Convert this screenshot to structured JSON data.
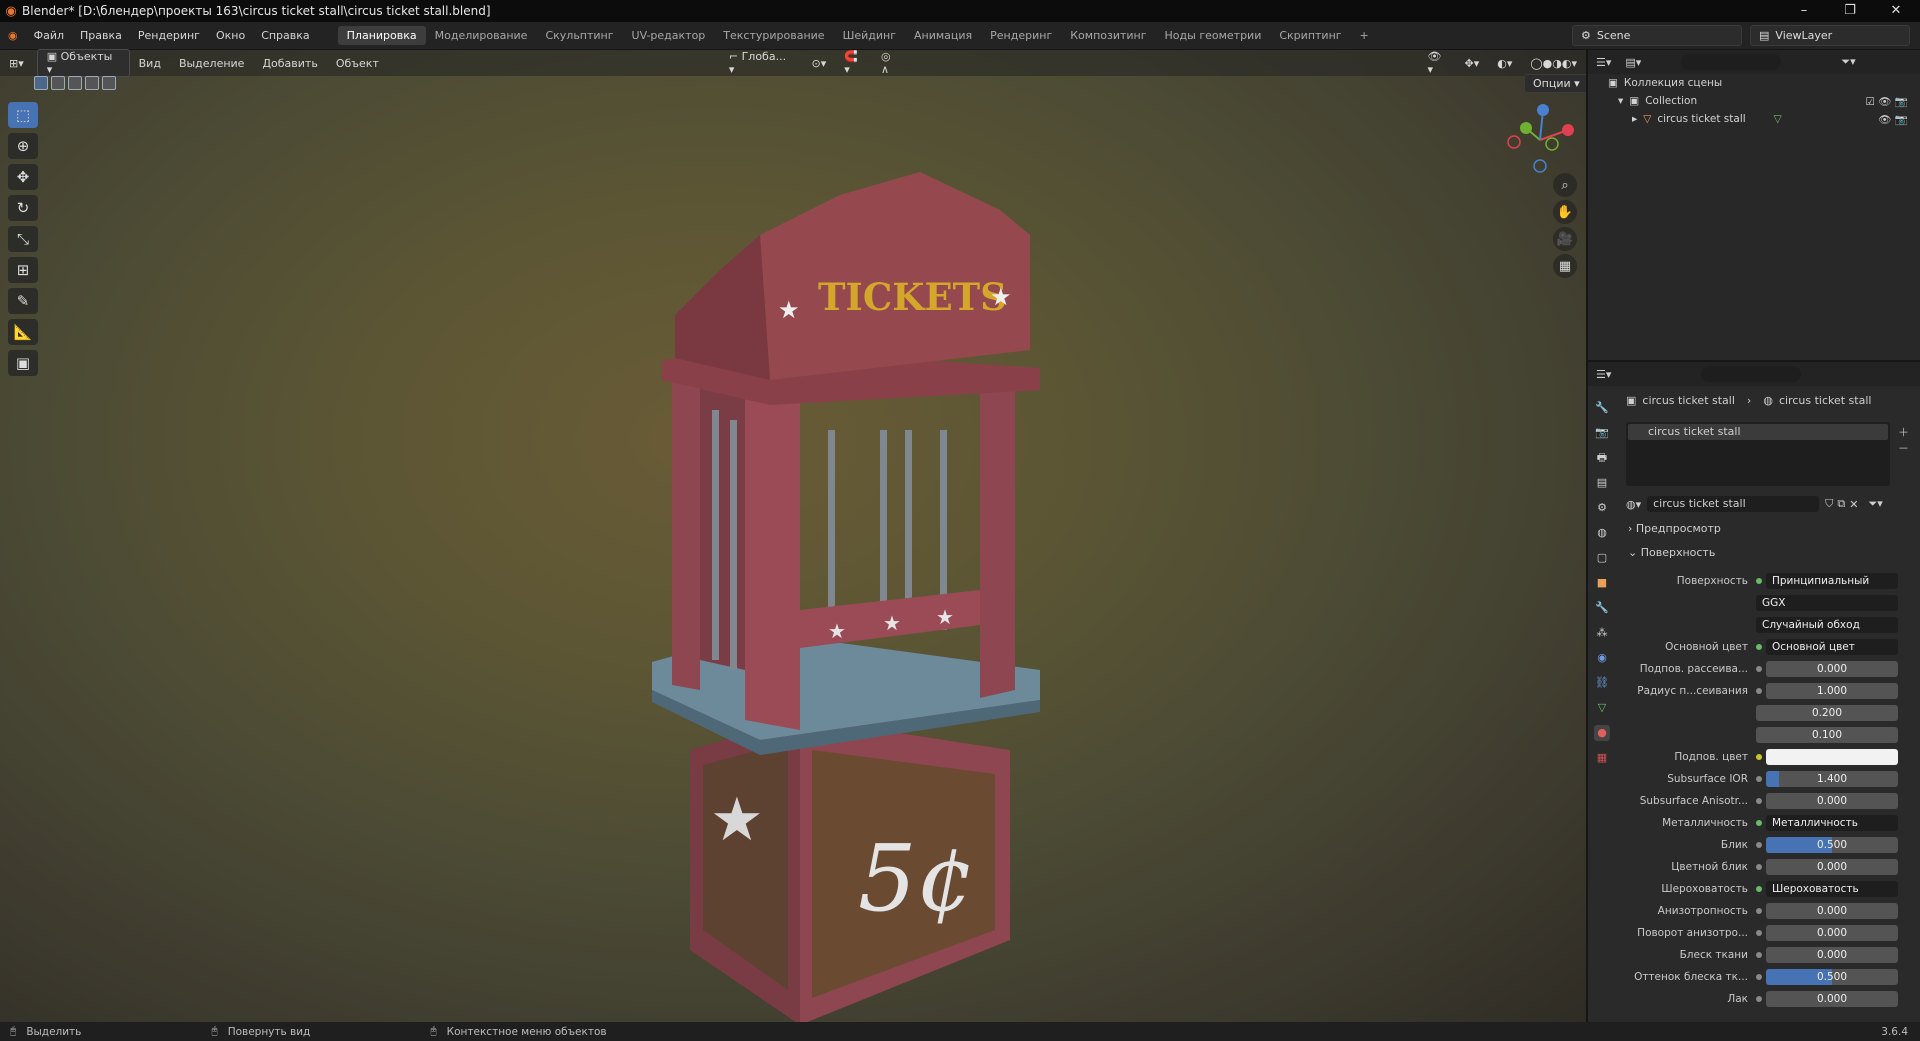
{
  "window": {
    "title": "Blender* [D:\\блендер\\проекты 163\\circus ticket stall\\circus ticket stall.blend]",
    "minimize": "–",
    "maximize": "❐",
    "close": "✕"
  },
  "menus": [
    "Файл",
    "Правка",
    "Рендеринг",
    "Окно",
    "Справка"
  ],
  "workspaces": [
    "Планировка",
    "Моделирование",
    "Скульптинг",
    "UV-редактор",
    "Текстурирование",
    "Шейдинг",
    "Анимация",
    "Рендеринг",
    "Композитинг",
    "Ноды геометрии",
    "Скриптинг",
    "+"
  ],
  "active_workspace": "Планировка",
  "scene": "Scene",
  "view_layer": "ViewLayer",
  "viewport_header": {
    "mode": "Объекты",
    "view": "Вид",
    "select": "Выделение",
    "add": "Добавить",
    "object": "Объект",
    "orientation": "Глоба...",
    "options": "Опции"
  },
  "model_text": {
    "sign": "TICKETS",
    "price": "5¢"
  },
  "outliner": {
    "scene_collection": "Коллекция сцены",
    "collection": "Collection",
    "object": "circus ticket stall"
  },
  "properties": {
    "breadcrumb_object": "circus ticket stall",
    "breadcrumb_material": "circus ticket stall",
    "slot": "circus ticket stall",
    "material_name": "circus ticket stall",
    "preview_panel": "Предпросмотр",
    "surface_panel": "Поверхность",
    "rows": [
      {
        "label": "Поверхность",
        "value": "Принципиальный BSDF",
        "type": "link"
      },
      {
        "label": "",
        "value": "GGX",
        "type": "dropdown"
      },
      {
        "label": "",
        "value": "Случайный обход",
        "type": "dropdown"
      },
      {
        "label": "Основной цвет",
        "value": "Основной цвет",
        "type": "link"
      },
      {
        "label": "Подпов. рассеива...",
        "value": "0.000",
        "type": "num",
        "fill": 0
      },
      {
        "label": "Радиус п...сеивания",
        "value": "1.000",
        "type": "num",
        "fill": 0
      },
      {
        "label": "",
        "value": "0.200",
        "type": "num",
        "fill": 0
      },
      {
        "label": "",
        "value": "0.100",
        "type": "num",
        "fill": 0
      },
      {
        "label": "Подпов. цвет",
        "value": "",
        "type": "color"
      },
      {
        "label": "Subsurface IOR",
        "value": "1.400",
        "type": "num",
        "fill": 0.1
      },
      {
        "label": "Subsurface Anisotr...",
        "value": "0.000",
        "type": "num",
        "fill": 0
      },
      {
        "label": "Металличность",
        "value": "Металличность",
        "type": "link"
      },
      {
        "label": "Блик",
        "value": "0.500",
        "type": "num",
        "fill": 0.5
      },
      {
        "label": "Цветной блик",
        "value": "0.000",
        "type": "num",
        "fill": 0
      },
      {
        "label": "Шероховатость",
        "value": "Шероховатость",
        "type": "link"
      },
      {
        "label": "Анизотропность",
        "value": "0.000",
        "type": "num",
        "fill": 0
      },
      {
        "label": "Поворот анизотро...",
        "value": "0.000",
        "type": "num",
        "fill": 0
      },
      {
        "label": "Блеск ткани",
        "value": "0.000",
        "type": "num",
        "fill": 0
      },
      {
        "label": "Оттенок блеска тк...",
        "value": "0.500",
        "type": "num",
        "fill": 0.5
      },
      {
        "label": "Лак",
        "value": "0.000",
        "type": "num",
        "fill": 0
      }
    ]
  },
  "statusbar": {
    "select": "Выделить",
    "rotate": "Повернуть вид",
    "context": "Контекстное меню объектов",
    "version": "3.6.4"
  },
  "colors": {
    "accent": "#4772b3",
    "stall_red": "#8e4650",
    "counter_blue": "#6d8a9b",
    "sign_gold": "#d4a629"
  }
}
